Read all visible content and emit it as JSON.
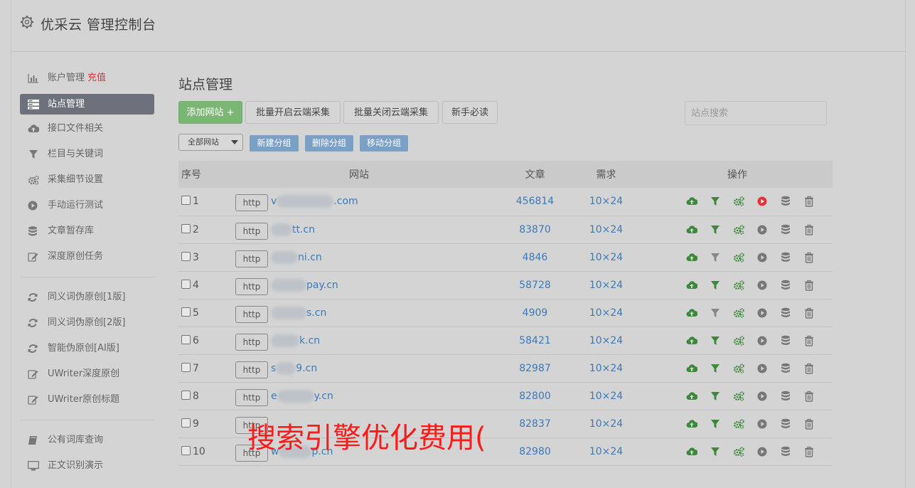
{
  "app": {
    "title": "优采云 管理控制台"
  },
  "sidebar": {
    "items": [
      {
        "label": "账户管理",
        "badge": "充值",
        "icon": "bar-chart-icon"
      },
      {
        "label": "站点管理",
        "icon": "server-list-icon",
        "active": true
      },
      {
        "label": "接口文件相关",
        "icon": "cloud-upload-icon"
      },
      {
        "label": "栏目与关键词",
        "icon": "filter-icon"
      },
      {
        "label": "采集细节设置",
        "icon": "cogs-icon"
      },
      {
        "label": "手动运行测试",
        "icon": "play-circle-icon"
      },
      {
        "label": "文章暂存库",
        "icon": "database-icon"
      },
      {
        "label": "深度原创任务",
        "icon": "edit-icon"
      }
    ],
    "items2": [
      {
        "label": "同义词伪原创[1版]",
        "icon": "refresh-icon"
      },
      {
        "label": "同义词伪原创[2版]",
        "icon": "refresh-icon"
      },
      {
        "label": "智能伪原创[AI版]",
        "icon": "refresh-icon"
      },
      {
        "label": "UWriter深度原创",
        "icon": "edit-icon"
      },
      {
        "label": "UWriter原创标题",
        "icon": "edit-icon"
      }
    ],
    "items3": [
      {
        "label": "公有词库查询",
        "icon": "book-icon"
      },
      {
        "label": "正文识别演示",
        "icon": "monitor-icon"
      }
    ]
  },
  "main": {
    "heading": "站点管理",
    "buttons": {
      "add": "添加网站 +",
      "enable_all": "批量开启云端采集",
      "disable_all": "批量关闭云端采集",
      "guide": "新手必读"
    },
    "search_placeholder": "站点搜索",
    "group_select": "全部网站",
    "group_buttons": {
      "new": "新建分组",
      "delete": "删除分组",
      "move": "移动分组"
    },
    "table": {
      "headers": [
        "序号",
        "网站",
        "文章",
        "需求",
        "操作"
      ],
      "protocol_label": "http",
      "rows": [
        {
          "no": "1",
          "prefix": "v",
          "suffix": ".com",
          "articles": "456814",
          "demand": "10×24",
          "filter_on": true,
          "running": true
        },
        {
          "no": "2",
          "prefix": "",
          "suffix": "tt.cn",
          "articles": "83870",
          "demand": "10×24",
          "filter_on": true,
          "running": false
        },
        {
          "no": "3",
          "prefix": "",
          "suffix": "ni.cn",
          "articles": "4846",
          "demand": "10×24",
          "filter_on": false,
          "running": false
        },
        {
          "no": "4",
          "prefix": "",
          "suffix": "pay.cn",
          "articles": "58728",
          "demand": "10×24",
          "filter_on": true,
          "running": false
        },
        {
          "no": "5",
          "prefix": "",
          "suffix": "s.cn",
          "articles": "4909",
          "demand": "10×24",
          "filter_on": false,
          "running": false
        },
        {
          "no": "6",
          "prefix": "",
          "suffix": "k.cn",
          "articles": "58421",
          "demand": "10×24",
          "filter_on": true,
          "running": false
        },
        {
          "no": "7",
          "prefix": "s",
          "suffix": "9.cn",
          "articles": "82987",
          "demand": "10×24",
          "filter_on": true,
          "running": false
        },
        {
          "no": "8",
          "prefix": "e",
          "suffix": "y.cn",
          "articles": "82800",
          "demand": "10×24",
          "filter_on": true,
          "running": false
        },
        {
          "no": "9",
          "prefix": "",
          "suffix": "",
          "articles": "82837",
          "demand": "10×24",
          "filter_on": true,
          "running": false
        },
        {
          "no": "10",
          "prefix": "w",
          "suffix": "p.cn",
          "articles": "82980",
          "demand": "10×24",
          "filter_on": true,
          "running": false
        }
      ]
    }
  },
  "overlay": {
    "text": "搜索引擎优化费用("
  },
  "colors": {
    "accent_green": "#3a8a3a",
    "link_blue": "#3b7ab8",
    "danger_red": "#e0343a",
    "active_nav": "#6c717c",
    "group_button": "#7ba0c6"
  }
}
